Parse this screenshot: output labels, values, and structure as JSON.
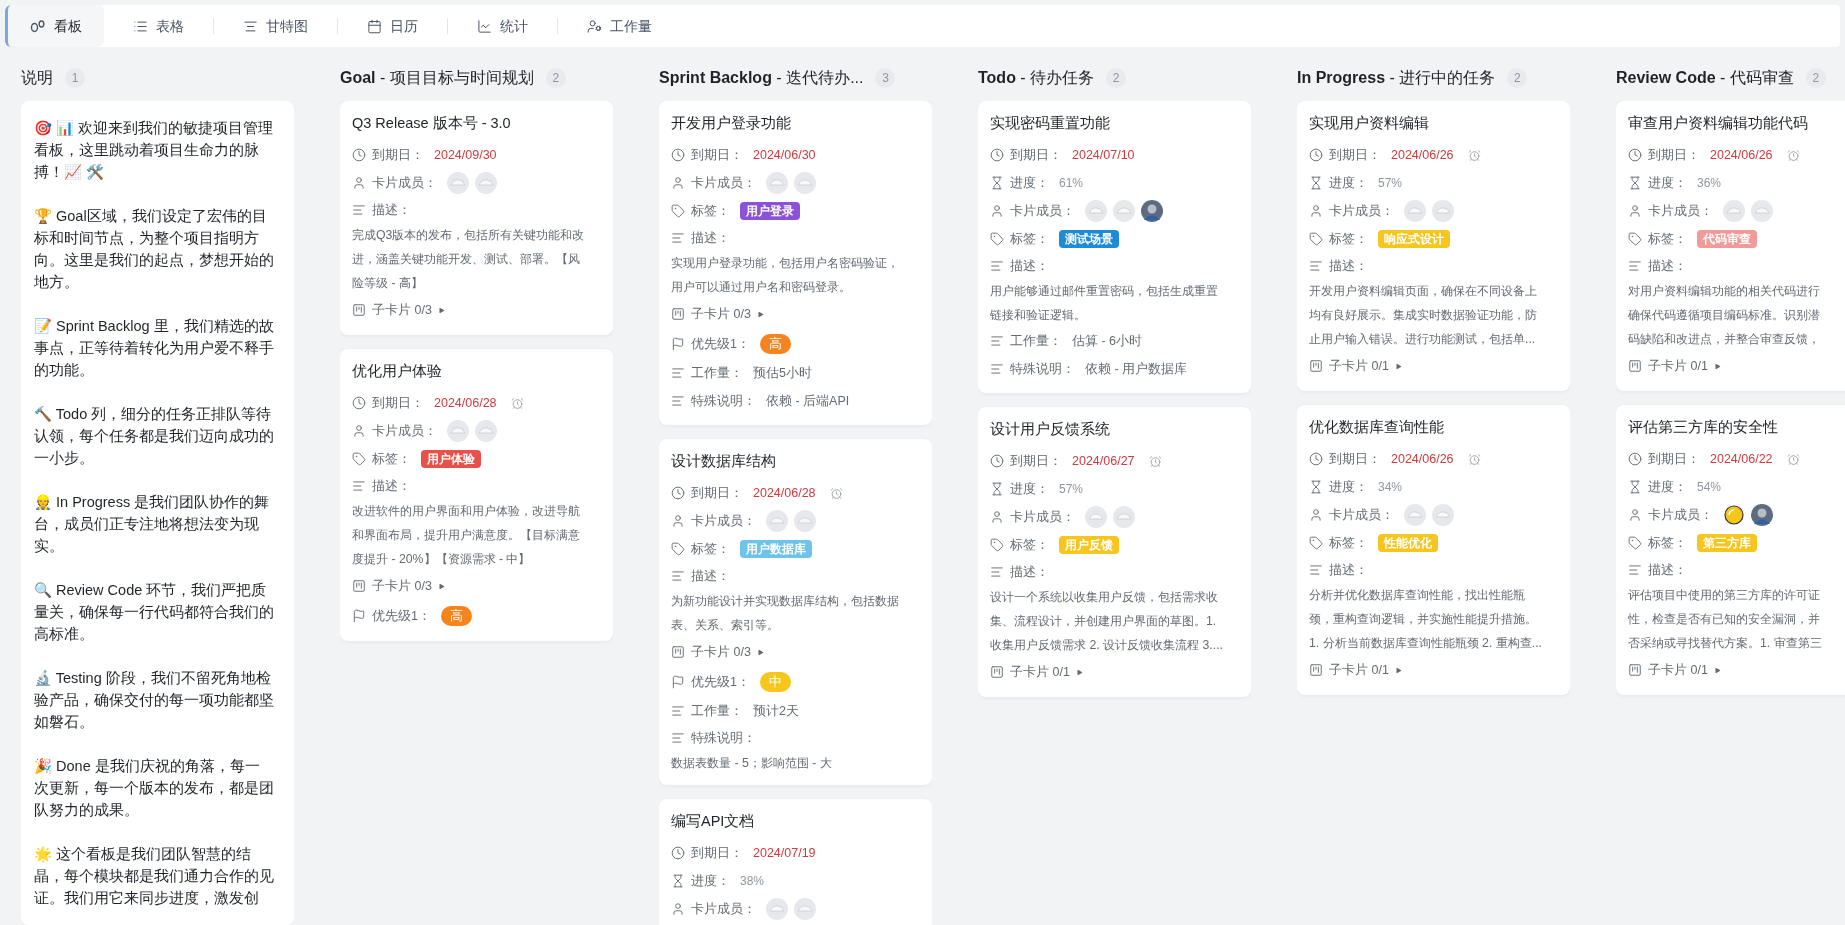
{
  "tabs": [
    {
      "label": "看板",
      "kind": "board",
      "selected": true
    },
    {
      "label": "表格",
      "kind": "table",
      "selected": false
    },
    {
      "label": "甘特图",
      "kind": "gantt",
      "selected": false
    },
    {
      "label": "日历",
      "kind": "calendar",
      "selected": false
    },
    {
      "label": "统计",
      "kind": "stats",
      "selected": false
    },
    {
      "label": "工作量",
      "kind": "workload",
      "selected": false
    }
  ],
  "columns": [
    {
      "title": "说明",
      "count": "1",
      "kind": "notes",
      "paragraphs": [
        {
          "lines": [
            "🎯 📊 欢迎来到我们的敏捷项目管理",
            "看板，这里跳动着项目生命力的脉",
            "搏！📈 🛠️"
          ]
        },
        {
          "lines": [
            "🏆 Goal区域，我们设定了宏伟的目",
            "标和时间节点，为整个项目指明方",
            "向。这里是我们的起点，梦想开始的",
            "地方。"
          ]
        },
        {
          "lines": [
            "📝 Sprint Backlog 里，我们精选的故",
            "事点，正等待着转化为用户爱不释手",
            "的功能。"
          ]
        },
        {
          "lines": [
            "🔨 Todo 列，细分的任务正排队等待",
            "认领，每个任务都是我们迈向成功的",
            "一小步。"
          ]
        },
        {
          "lines": [
            "👷 In Progress 是我们团队协作的舞",
            "台，成员们正专注地将想法变为现",
            "实。"
          ]
        },
        {
          "lines": [
            "🔍 Review Code 环节，我们严把质",
            "量关，确保每一行代码都符合我们的",
            "高标准。"
          ]
        },
        {
          "lines": [
            "🔬 Testing 阶段，我们不留死角地检",
            "验产品，确保交付的每一项功能都坚",
            "如磐石。"
          ]
        },
        {
          "lines": [
            "🎉 Done 是我们庆祝的角落，每一",
            "次更新，每一个版本的发布，都是团",
            "队努力的成果。"
          ]
        },
        {
          "lines": [
            "🌟 这个看板是我们团队智慧的结",
            "晶，每个模块都是我们通力合作的见",
            "证。我们用它来同步进度，激发创"
          ]
        }
      ]
    },
    {
      "title": "**Goal** - 项目目标与时间规划",
      "count": "2",
      "kind": "cards",
      "cards": [
        {
          "title": "Q3 Release 版本号 - 3.0",
          "fields": [
            {
              "kind": "due",
              "label": "到期日：",
              "value": "2024/09/30",
              "reminder": false
            },
            {
              "kind": "members",
              "label": "卡片成员：",
              "avatars": [
                {
                  "kind": "default"
                },
                {
                  "kind": "default"
                }
              ]
            },
            {
              "kind": "description",
              "label": "描述：",
              "lines": [
                "完成Q3版本的发布，包括所有关键功能和改",
                "进，涵盖关键功能开发、测试、部署。【风",
                "险等级 - 高】"
              ]
            },
            {
              "kind": "subcards",
              "label": "子卡片 0/3"
            }
          ]
        },
        {
          "title": "优化用户体验",
          "fields": [
            {
              "kind": "due",
              "label": "到期日：",
              "value": "2024/06/28",
              "reminder": true
            },
            {
              "kind": "members",
              "label": "卡片成员：",
              "avatars": [
                {
                  "kind": "default"
                },
                {
                  "kind": "default"
                }
              ]
            },
            {
              "kind": "tags",
              "label": "标签：",
              "tags": [
                {
                  "text": "用户体验",
                  "color": "#e8514a"
                }
              ]
            },
            {
              "kind": "description",
              "label": "描述：",
              "lines": [
                "改进软件的用户界面和用户体验，改进导航",
                "和界面布局，提升用户满意度。【目标满意",
                "度提升 - 20%】【资源需求 - 中】"
              ]
            },
            {
              "kind": "subcards",
              "label": "子卡片 0/3"
            },
            {
              "kind": "priority",
              "label": "优先级1：",
              "value": "高",
              "color": "#f5841f"
            }
          ]
        }
      ]
    },
    {
      "title": "**Sprint Backlog** - 迭代待办...",
      "count": "3",
      "kind": "cards",
      "cards": [
        {
          "title": "开发用户登录功能",
          "fields": [
            {
              "kind": "due",
              "label": "到期日：",
              "value": "2024/06/30",
              "reminder": false
            },
            {
              "kind": "members",
              "label": "卡片成员：",
              "avatars": [
                {
                  "kind": "default"
                },
                {
                  "kind": "default"
                }
              ]
            },
            {
              "kind": "tags",
              "label": "标签：",
              "tags": [
                {
                  "text": "用户登录",
                  "color": "#8c52d6"
                }
              ]
            },
            {
              "kind": "description",
              "label": "描述：",
              "lines": [
                "实现用户登录功能，包括用户名密码验证，",
                "用户可以通过用户名和密码登录。"
              ]
            },
            {
              "kind": "subcards",
              "label": "子卡片 0/3"
            },
            {
              "kind": "priority",
              "label": "优先级1：",
              "value": "高",
              "color": "#f5841f"
            },
            {
              "kind": "text",
              "label": "工作量：",
              "value": "预估5小时"
            },
            {
              "kind": "text",
              "label": "特殊说明：",
              "value": "依赖 - 后端API"
            }
          ]
        },
        {
          "title": "设计数据库结构",
          "fields": [
            {
              "kind": "due",
              "label": "到期日：",
              "value": "2024/06/28",
              "reminder": true
            },
            {
              "kind": "members",
              "label": "卡片成员：",
              "avatars": [
                {
                  "kind": "default"
                },
                {
                  "kind": "default"
                }
              ]
            },
            {
              "kind": "tags",
              "label": "标签：",
              "tags": [
                {
                  "text": "用户数据库",
                  "color": "#6ec3ea"
                }
              ]
            },
            {
              "kind": "description",
              "label": "描述：",
              "lines": [
                "为新功能设计并实现数据库结构，包括数据",
                "表、关系、索引等。"
              ]
            },
            {
              "kind": "subcards",
              "label": "子卡片 0/3"
            },
            {
              "kind": "priority",
              "label": "优先级1：",
              "value": "中",
              "color": "#f7c61c"
            },
            {
              "kind": "text",
              "label": "工作量：",
              "value": "预计2天"
            },
            {
              "kind": "description",
              "label": "特殊说明：",
              "lines": [
                "数据表数量 - 5；影响范围 - 大"
              ]
            }
          ]
        },
        {
          "title": "编写API文档",
          "fields": [
            {
              "kind": "due",
              "label": "到期日：",
              "value": "2024/07/19",
              "reminder": false
            },
            {
              "kind": "progress",
              "label": "进度：",
              "value": "38%"
            },
            {
              "kind": "members",
              "label": "卡片成员：",
              "avatars": [
                {
                  "kind": "default"
                },
                {
                  "kind": "default"
                }
              ]
            }
          ]
        }
      ]
    },
    {
      "title": "**Todo** - 待办任务",
      "count": "2",
      "kind": "cards",
      "cards": [
        {
          "title": "实现密码重置功能",
          "fields": [
            {
              "kind": "due",
              "label": "到期日：",
              "value": "2024/07/10",
              "reminder": false
            },
            {
              "kind": "progress",
              "label": "进度：",
              "value": "61%"
            },
            {
              "kind": "members",
              "label": "卡片成员：",
              "avatars": [
                {
                  "kind": "default"
                },
                {
                  "kind": "default"
                },
                {
                  "kind": "photo"
                }
              ]
            },
            {
              "kind": "tags",
              "label": "标签：",
              "tags": [
                {
                  "text": "测试场景",
                  "color": "#1f8ad6"
                }
              ]
            },
            {
              "kind": "description",
              "label": "描述：",
              "lines": [
                "用户能够通过邮件重置密码，包括生成重置",
                "链接和验证逻辑。"
              ]
            },
            {
              "kind": "text",
              "label": "工作量：",
              "value": "估算 - 6小时"
            },
            {
              "kind": "text",
              "label": "特殊说明：",
              "value": "依赖 - 用户数据库"
            }
          ]
        },
        {
          "title": "设计用户反馈系统",
          "fields": [
            {
              "kind": "due",
              "label": "到期日：",
              "value": "2024/06/27",
              "reminder": true
            },
            {
              "kind": "progress",
              "label": "进度：",
              "value": "57%"
            },
            {
              "kind": "members",
              "label": "卡片成员：",
              "avatars": [
                {
                  "kind": "default"
                },
                {
                  "kind": "default"
                }
              ]
            },
            {
              "kind": "tags",
              "label": "标签：",
              "tags": [
                {
                  "text": "用户反馈",
                  "color": "#f6c61f"
                }
              ]
            },
            {
              "kind": "description",
              "label": "描述：",
              "lines": [
                "设计一个系统以收集用户反馈，包括需求收",
                "集、流程设计，并创建用户界面的草图。1.",
                "收集用户反馈需求 2. 设计反馈收集流程 3...."
              ]
            },
            {
              "kind": "subcards",
              "label": "子卡片 0/1"
            }
          ]
        }
      ]
    },
    {
      "title": "**In Progress** - 进行中的任务",
      "count": "2",
      "kind": "cards",
      "cards": [
        {
          "title": "实现用户资料编辑",
          "fields": [
            {
              "kind": "due",
              "label": "到期日：",
              "value": "2024/06/26",
              "reminder": true
            },
            {
              "kind": "progress",
              "label": "进度：",
              "value": "57%"
            },
            {
              "kind": "members",
              "label": "卡片成员：",
              "avatars": [
                {
                  "kind": "default"
                },
                {
                  "kind": "default"
                }
              ]
            },
            {
              "kind": "tags",
              "label": "标签：",
              "tags": [
                {
                  "text": "响应式设计",
                  "color": "#f6c61f"
                }
              ]
            },
            {
              "kind": "description",
              "label": "描述：",
              "lines": [
                "开发用户资料编辑页面，确保在不同设备上",
                "均有良好展示。集成实时数据验证功能，防",
                "止用户输入错误。进行功能测试，包括单..."
              ]
            },
            {
              "kind": "subcards",
              "label": "子卡片 0/1"
            }
          ]
        },
        {
          "title": "优化数据库查询性能",
          "fields": [
            {
              "kind": "due",
              "label": "到期日：",
              "value": "2024/06/26",
              "reminder": true
            },
            {
              "kind": "progress",
              "label": "进度：",
              "value": "34%"
            },
            {
              "kind": "members",
              "label": "卡片成员：",
              "avatars": [
                {
                  "kind": "default"
                },
                {
                  "kind": "default"
                }
              ]
            },
            {
              "kind": "tags",
              "label": "标签：",
              "tags": [
                {
                  "text": "性能优化",
                  "color": "#f6c61f"
                }
              ]
            },
            {
              "kind": "description",
              "label": "描述：",
              "lines": [
                "分析并优化数据库查询性能，找出性能瓶",
                "颈，重构查询逻辑，并实施性能提升措施。",
                "1. 分析当前数据库查询性能瓶颈 2. 重构查..."
              ]
            },
            {
              "kind": "subcards",
              "label": "子卡片 0/1"
            }
          ]
        }
      ]
    },
    {
      "title": "**Review Code** - 代码审查",
      "count": "2",
      "kind": "cards",
      "cards": [
        {
          "title": "审查用户资料编辑功能代码",
          "fields": [
            {
              "kind": "due",
              "label": "到期日：",
              "value": "2024/06/26",
              "reminder": true
            },
            {
              "kind": "progress",
              "label": "进度：",
              "value": "36%"
            },
            {
              "kind": "members",
              "label": "卡片成员：",
              "avatars": [
                {
                  "kind": "default"
                },
                {
                  "kind": "default"
                }
              ]
            },
            {
              "kind": "tags",
              "label": "标签：",
              "tags": [
                {
                  "text": "代码审查",
                  "color": "#f09a9a"
                }
              ]
            },
            {
              "kind": "description",
              "label": "描述：",
              "lines": [
                "对用户资料编辑功能的相关代码进行",
                "确保代码遵循项目编码标准。识别潜",
                "码缺陷和改进点，并整合审查反馈，"
              ]
            },
            {
              "kind": "subcards",
              "label": "子卡片 0/1"
            }
          ]
        },
        {
          "title": "评估第三方库的安全性",
          "fields": [
            {
              "kind": "due",
              "label": "到期日：",
              "value": "2024/06/22",
              "reminder": true
            },
            {
              "kind": "progress",
              "label": "进度：",
              "value": "54%"
            },
            {
              "kind": "members",
              "label": "卡片成员：",
              "avatars": [
                {
                  "kind": "emoji"
                },
                {
                  "kind": "photo"
                }
              ]
            },
            {
              "kind": "tags",
              "label": "标签：",
              "tags": [
                {
                  "text": "第三方库",
                  "color": "#f6c61f"
                }
              ]
            },
            {
              "kind": "description",
              "label": "描述：",
              "lines": [
                "评估项目中使用的第三方库的许可证",
                "性，检查是否有已知的安全漏洞，并",
                "否采纳或寻找替代方案。1. 审查第三"
              ]
            },
            {
              "kind": "subcards",
              "label": "子卡片 0/1"
            }
          ]
        }
      ]
    }
  ]
}
